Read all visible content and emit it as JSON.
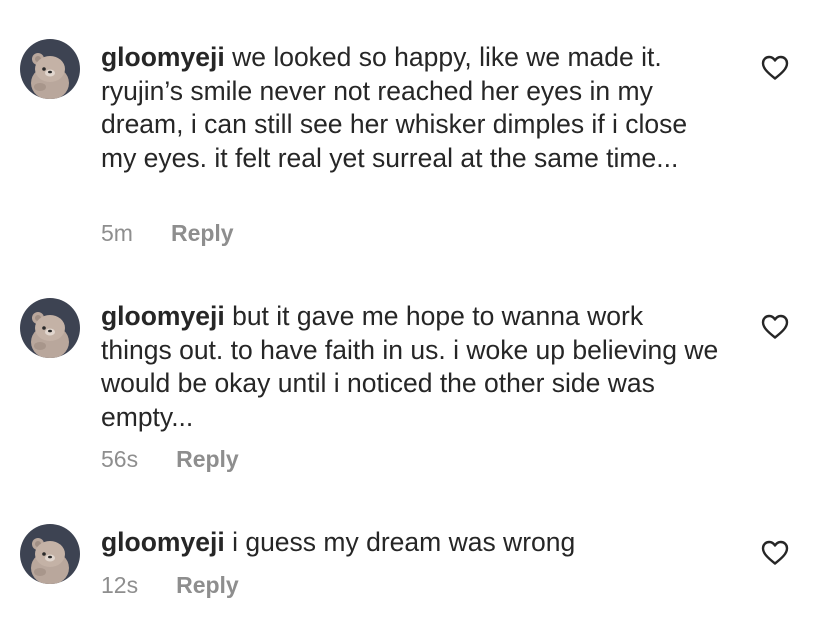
{
  "comments": [
    {
      "username": "gloomyeji",
      "text": "we looked so happy, like we made it. ryujin’s smile never not reached her eyes in my dream, i can still see her whisker dimples if i close my eyes. it felt real yet surreal at the same time...",
      "time": "5m",
      "reply_label": "Reply"
    },
    {
      "username": "gloomyeji",
      "text": "but it gave me hope to wanna work things out. to have faith in us. i woke up believing we would be okay until i noticed the other side was empty...",
      "time": "56s",
      "reply_label": "Reply"
    },
    {
      "username": "gloomyeji",
      "text": "i guess my dream was wrong",
      "time": "12s",
      "reply_label": "Reply"
    }
  ],
  "icons": {
    "like": "heart-outline-icon",
    "avatar": "bear-avatar"
  },
  "colors": {
    "text": "#262626",
    "meta": "#8e8e8e",
    "avatar_bg": "#3a4150"
  }
}
